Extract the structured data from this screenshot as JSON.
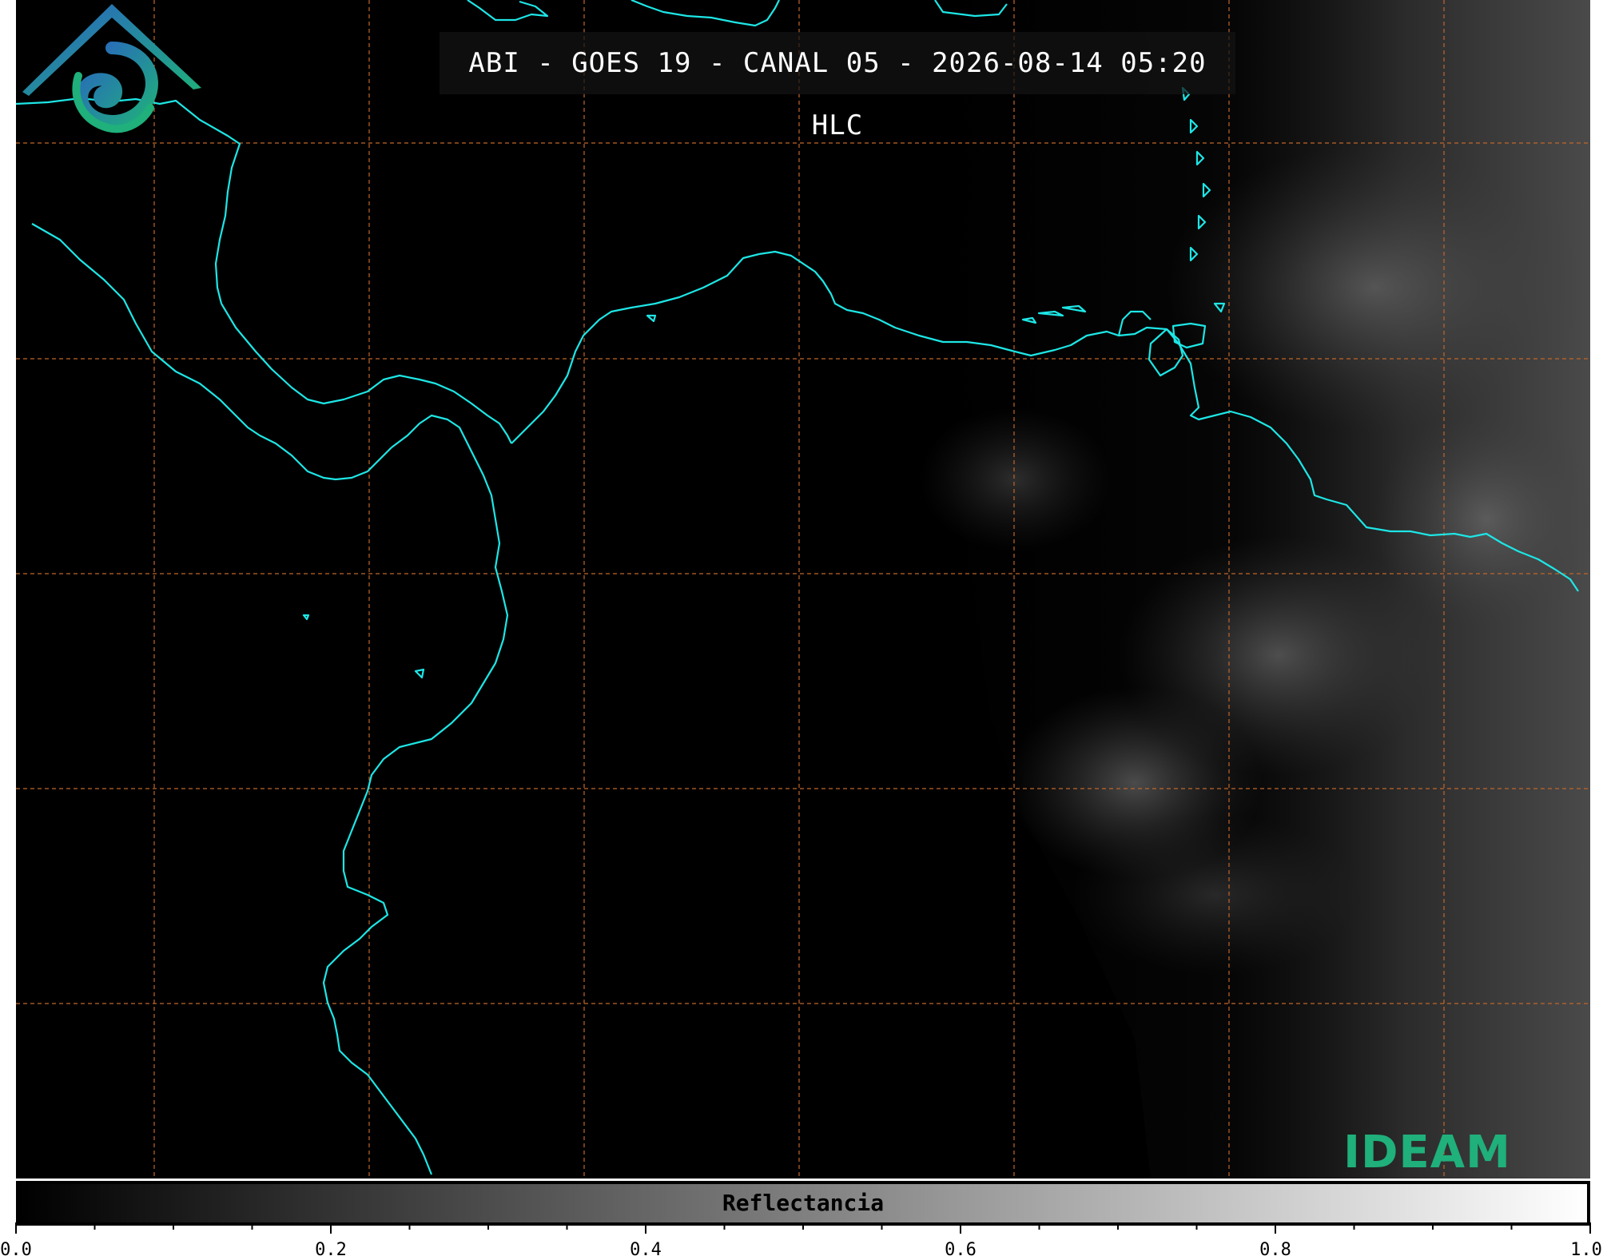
{
  "title": "ABI - GOES 19 - CANAL 05 - 2026-08-14 05:20 HLC",
  "logo": {
    "text": "IDEAM"
  },
  "colorbar": {
    "label": "Reflectancia",
    "min": 0.0,
    "max": 1.0,
    "colormap": "grayscale",
    "tick_labels": [
      "0.0",
      "0.2",
      "0.4",
      "0.6",
      "0.8",
      "1.0"
    ]
  },
  "map": {
    "coastline_color": "#1ee6e6",
    "grid_color": "#c0662a",
    "grid_style": "dashed"
  }
}
